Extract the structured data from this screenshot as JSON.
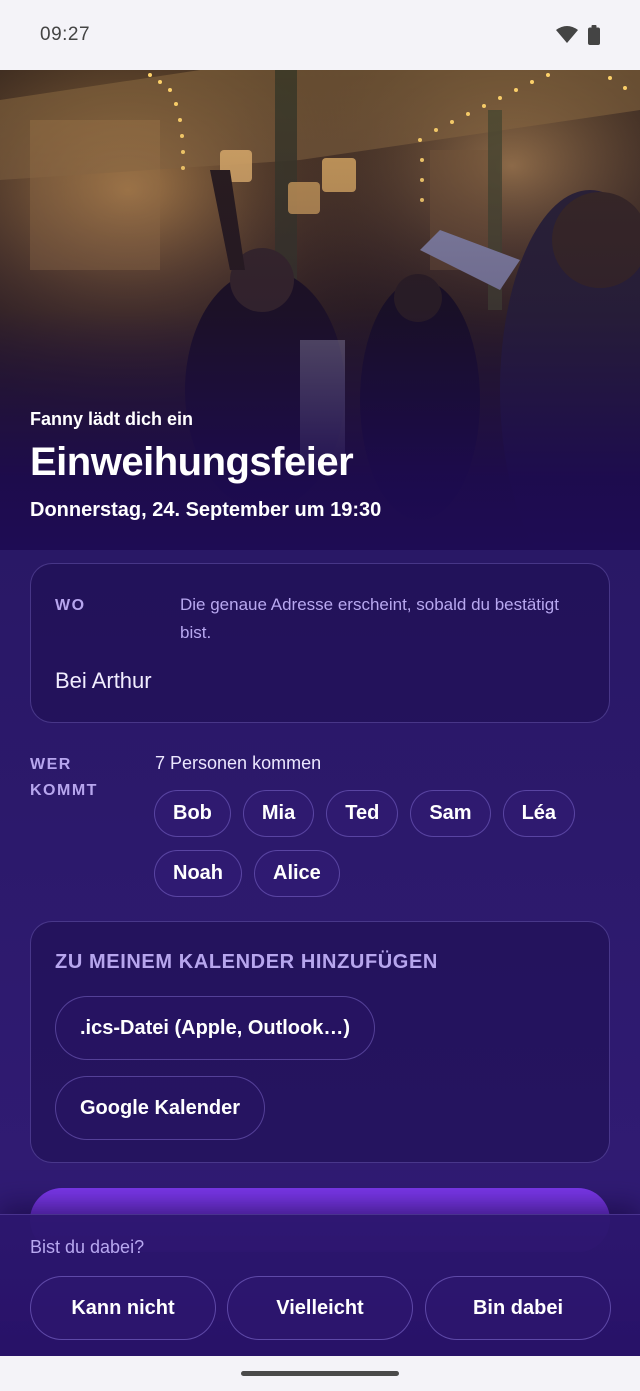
{
  "status_bar": {
    "time": "09:27"
  },
  "event": {
    "host_line": "Fanny lädt dich ein",
    "title": "Einweihungsfeier",
    "datetime": "Donnerstag, 24. September um 19:30"
  },
  "where": {
    "label": "WO",
    "hint": "Die genaue Adresse erscheint, sobald du bestätigt bist.",
    "place": "Bei Arthur"
  },
  "who": {
    "label": "WER KOMMT",
    "count_text": "7 Personen kommen",
    "guests": [
      "Bob",
      "Mia",
      "Ted",
      "Sam",
      "Léa",
      "Noah",
      "Alice"
    ]
  },
  "calendar": {
    "title": "ZU MEINEM KALENDER HINZUFÜGEN",
    "ics_label": ".ics-Datei (Apple, Outlook…)",
    "google_label": "Google Kalender"
  },
  "primary_action": {
    "label": ""
  },
  "rsvp": {
    "question": "Bist du dabei?",
    "no_label": "Kann nicht",
    "maybe_label": "Vielleicht",
    "yes_label": "Bin dabei"
  },
  "colors": {
    "background": "#2a1868",
    "accent": "#7a37e8",
    "muted_text": "#b8a8f0"
  }
}
